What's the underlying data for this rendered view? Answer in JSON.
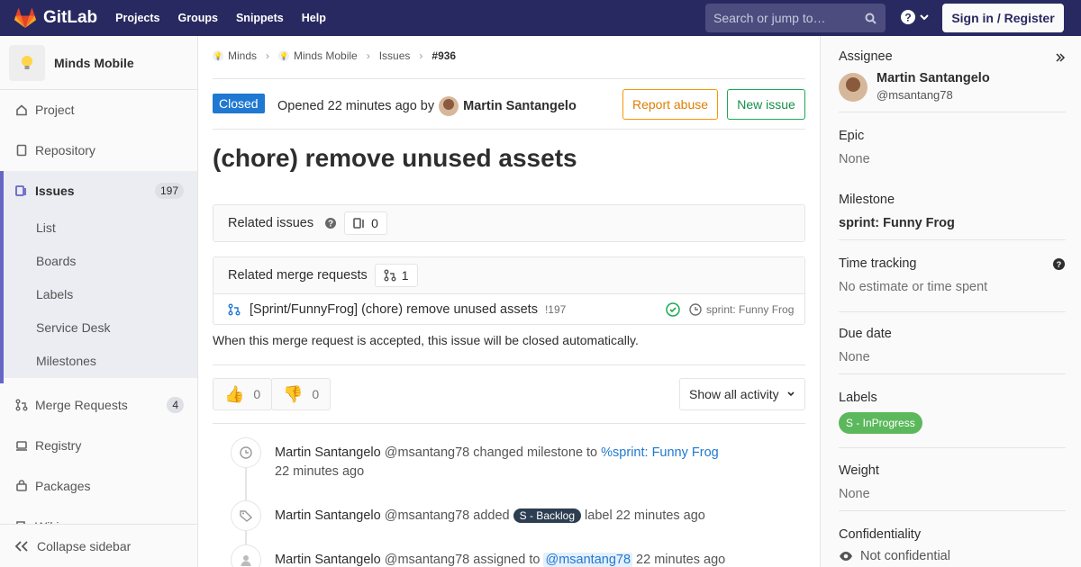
{
  "nav": {
    "brand": "GitLab",
    "links": [
      "Projects",
      "Groups",
      "Snippets",
      "Help"
    ],
    "search_placeholder": "Search or jump to…",
    "signin_label": "Sign in / Register"
  },
  "sidebar": {
    "project_name": "Minds Mobile",
    "items": [
      {
        "label": "Project",
        "icon": "home-icon"
      },
      {
        "label": "Repository",
        "icon": "doc-icon"
      },
      {
        "label": "Issues",
        "icon": "issues-icon",
        "count": "197"
      },
      {
        "label": "Merge Requests",
        "icon": "merge-request-icon",
        "count": "4"
      },
      {
        "label": "Registry",
        "icon": "container-icon"
      },
      {
        "label": "Packages",
        "icon": "package-icon"
      },
      {
        "label": "Wiki",
        "icon": "book-icon"
      }
    ],
    "issues_sub": [
      "List",
      "Boards",
      "Labels",
      "Service Desk",
      "Milestones"
    ],
    "collapse_label": "Collapse sidebar"
  },
  "breadcrumb": [
    "Minds",
    "Minds Mobile",
    "Issues",
    "#936"
  ],
  "issue": {
    "status": "Closed",
    "opened_text": "Opened 22 minutes ago by",
    "author": "Martin Santangelo",
    "report_label": "Report abuse",
    "new_issue_label": "New issue",
    "title": "(chore) remove unused assets"
  },
  "related_issues": {
    "label": "Related issues",
    "count": "0"
  },
  "related_mrs": {
    "label": "Related merge requests",
    "count": "1",
    "item_title": "[Sprint/FunnyFrog] (chore) remove unused assets",
    "item_ref": "!197",
    "item_milestone": "sprint: Funny Frog"
  },
  "auto_close_note": "When this merge request is accepted, this issue will be closed automatically.",
  "awards": {
    "thumbsup": "0",
    "thumbsdown": "0"
  },
  "activity_filter": "Show all activity",
  "timeline": [
    {
      "author": "Martin Santangelo",
      "handle": "@msantang78",
      "action": "changed milestone to",
      "target": "%sprint: Funny Frog",
      "time": "22 minutes ago",
      "icon": "clock-icon"
    },
    {
      "author": "Martin Santangelo",
      "handle": "@msantang78",
      "action": "added",
      "label": "S - Backlog",
      "after": "label",
      "time": "22 minutes ago",
      "icon": "tag-icon"
    },
    {
      "author": "Martin Santangelo",
      "handle": "@msantang78",
      "action": "assigned to",
      "target": "@msantang78",
      "time": "22 minutes ago",
      "icon": "user-icon"
    }
  ],
  "right": {
    "assignee_title": "Assignee",
    "assignee_name": "Martin Santangelo",
    "assignee_handle": "@msantang78",
    "epic_title": "Epic",
    "epic_value": "None",
    "milestone_title": "Milestone",
    "milestone_value": "sprint: Funny Frog",
    "time_title": "Time tracking",
    "time_value": "No estimate or time spent",
    "due_title": "Due date",
    "due_value": "None",
    "labels_title": "Labels",
    "label_value": "S - InProgress",
    "weight_title": "Weight",
    "weight_value": "None",
    "conf_title": "Confidentiality",
    "conf_value": "Not confidential"
  },
  "colors": {
    "nav": "#292961",
    "closed": "#1f78d1",
    "green": "#5cb85c",
    "orange": "#fc9403"
  }
}
